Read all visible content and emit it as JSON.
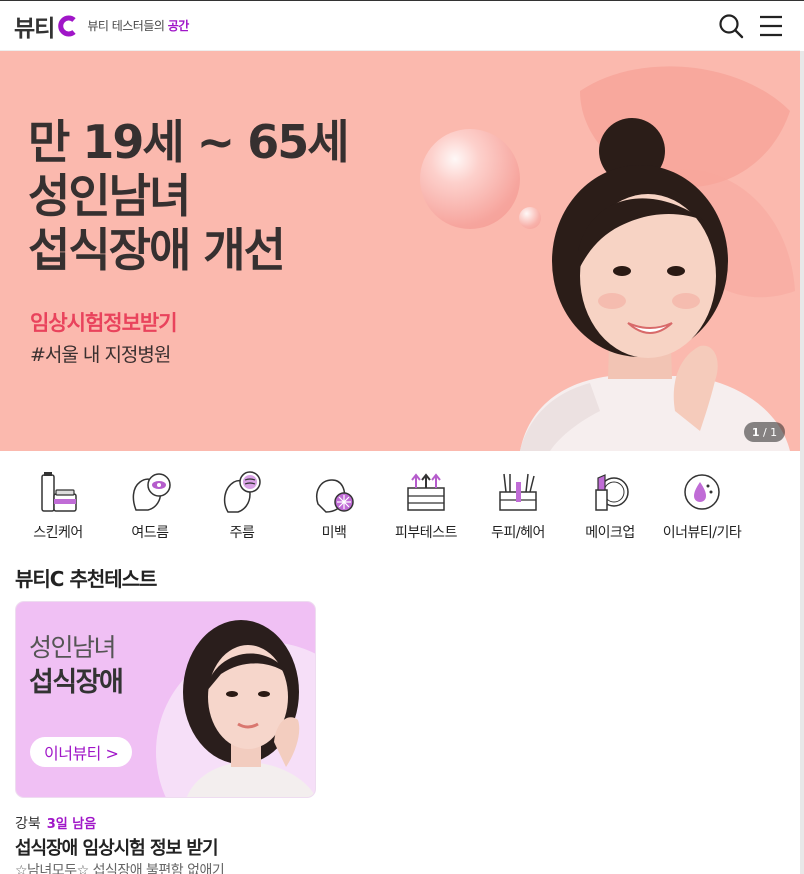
{
  "header": {
    "logo_text": "뷰티",
    "tagline_prefix": "뷰티 테스터들의",
    "tagline_accent": "공간"
  },
  "banner": {
    "title": "만 19세 ~ 65세\n성인남녀\n섭식장애 개선",
    "cta": "임상시험정보받기",
    "hashtag": "#서울 내 지정병원",
    "pager_current": "1",
    "pager_sep": " / ",
    "pager_total": "1",
    "background": "#fbb9ae"
  },
  "categories": [
    {
      "label": "스킨케어",
      "icon": "skincare-icon"
    },
    {
      "label": "여드름",
      "icon": "acne-icon"
    },
    {
      "label": "주름",
      "icon": "wrinkle-icon"
    },
    {
      "label": "미백",
      "icon": "whitening-icon"
    },
    {
      "label": "피부테스트",
      "icon": "skin-test-icon"
    },
    {
      "label": "두피/헤어",
      "icon": "scalp-hair-icon"
    },
    {
      "label": "메이크업",
      "icon": "makeup-icon"
    },
    {
      "label": "이너뷰티/기타",
      "icon": "inner-beauty-icon"
    }
  ],
  "section": {
    "title": "뷰티C 추천테스트"
  },
  "card": {
    "line1": "성인남녀",
    "line2": "섭식장애",
    "pill": "이너뷰티 >",
    "region": "강북",
    "days_left": "3일 남음",
    "title": "섭식장애 임상시험 정보 받기",
    "desc": "☆남녀모두☆ 섭식장애 불편함 없애기"
  },
  "colors": {
    "accent": "#a016c8",
    "banner_cta": "#e9435c"
  }
}
